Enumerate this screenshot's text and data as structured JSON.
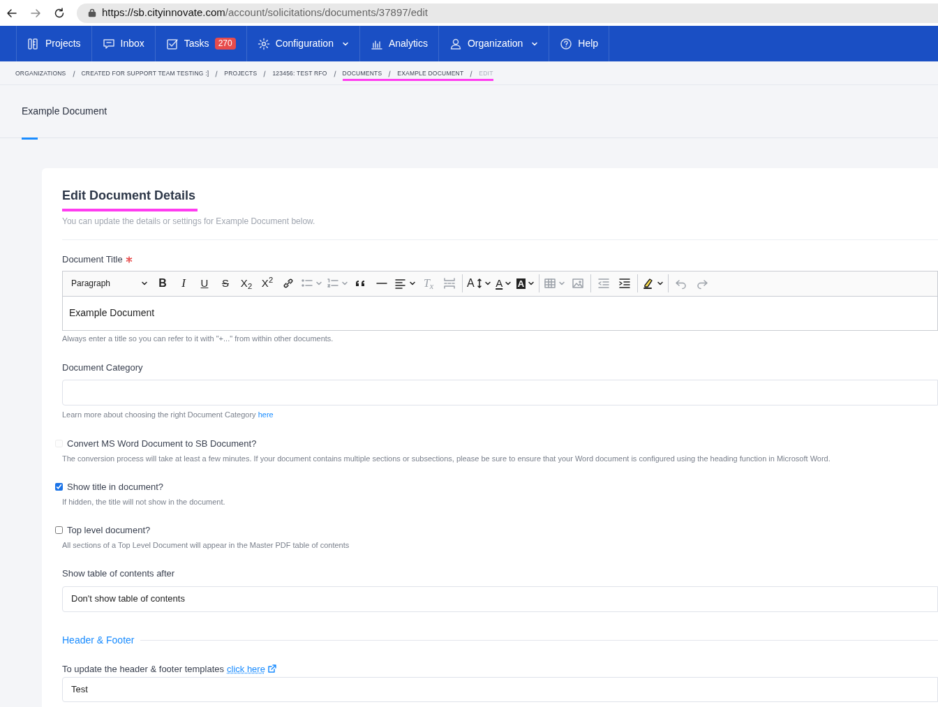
{
  "browser": {
    "url_host": "https://sb.cityinnovate.com",
    "url_path": "/account/solicitations/documents/37897/edit"
  },
  "nav": [
    {
      "label": "Projects",
      "dropdown": false
    },
    {
      "label": "Inbox",
      "dropdown": false
    },
    {
      "label": "Tasks",
      "badge": "270",
      "dropdown": false
    },
    {
      "label": "Configuration",
      "dropdown": true
    },
    {
      "label": "Analytics",
      "dropdown": false
    },
    {
      "label": "Organization",
      "dropdown": true
    },
    {
      "label": "Help",
      "dropdown": false
    }
  ],
  "breadcrumbs": [
    {
      "label": "ORGANIZATIONS",
      "current": false,
      "highlighted": false
    },
    {
      "label": "CREATED FOR SUPPORT TEAM TESTING :]",
      "current": false,
      "highlighted": false
    },
    {
      "label": "PROJECTS",
      "current": false,
      "highlighted": false
    },
    {
      "label": "123456: TEST RFO",
      "current": false,
      "highlighted": false
    },
    {
      "label": "DOCUMENTS",
      "current": false,
      "highlighted": true
    },
    {
      "label": "EXAMPLE DOCUMENT",
      "current": false,
      "highlighted": true
    },
    {
      "label": "EDIT",
      "current": true,
      "highlighted": true
    }
  ],
  "page_tabs": [
    {
      "label": "Example Document",
      "selected": true
    }
  ],
  "card": {
    "title": "Edit Document Details",
    "title_highlighted": true,
    "subtitle": "You can update the details or settings for Example Document below.",
    "title_field": {
      "label": "Document Title",
      "required": true,
      "block_style": "Paragraph",
      "value": "Example Document",
      "help": "Always enter a title so you can refer to it with \"+...\" from within other documents."
    },
    "toolbar": [
      {
        "kind": "bold",
        "text": "B",
        "disabled": false
      },
      {
        "kind": "italic",
        "text": "I",
        "disabled": false
      },
      {
        "kind": "underline",
        "text": "U",
        "disabled": false
      },
      {
        "kind": "strike",
        "text": "S",
        "disabled": false
      },
      {
        "kind": "subscript",
        "text": "X$_{2}$",
        "disabled": false
      },
      {
        "kind": "superscript",
        "text": "X$^{2}$",
        "disabled": false
      },
      {
        "kind": "link",
        "disabled": false
      },
      {
        "kind": "bullets",
        "disabled": true
      },
      {
        "kind": "numbers",
        "disabled": true
      },
      {
        "kind": "quote",
        "disabled": false
      },
      {
        "kind": "rule",
        "disabled": false
      },
      {
        "kind": "align",
        "disabled": false
      },
      {
        "kind": "clear",
        "text": "T$_{x}$",
        "disabled": true
      },
      {
        "kind": "pagebreak",
        "disabled": true
      },
      {
        "kind": "separator"
      },
      {
        "kind": "fontsize",
        "text": "A",
        "disabled": false
      },
      {
        "kind": "fontcolor",
        "text": "A",
        "disabled": false
      },
      {
        "kind": "bgcolor",
        "text": "A",
        "disabled": false
      },
      {
        "kind": "separator"
      },
      {
        "kind": "table",
        "disabled": true
      },
      {
        "kind": "image",
        "disabled": true
      },
      {
        "kind": "separator"
      },
      {
        "kind": "outdent",
        "disabled": true
      },
      {
        "kind": "indent",
        "disabled": false
      },
      {
        "kind": "separator"
      },
      {
        "kind": "highlight",
        "disabled": false
      },
      {
        "kind": "separator"
      },
      {
        "kind": "undo",
        "disabled": true
      },
      {
        "kind": "redo",
        "disabled": true
      }
    ],
    "category": {
      "label": "Document Category",
      "help": "Learn more about choosing the right Document Category",
      "help_link": "here"
    },
    "options": [
      {
        "label": "Convert MS Word Document to SB Document?",
        "checked": false,
        "disabled": true,
        "help": "The conversion process will take at least a few minutes. If your document contains multiple sections or subsections, please be sure to ensure that your Word document is configured using the heading function in Microsoft Word."
      },
      {
        "label": "Show title in document?",
        "checked": true,
        "disabled": false,
        "help": "If hidden, the title will not show in the document."
      },
      {
        "label": "Top level document?",
        "checked": false,
        "disabled": false,
        "help": "All sections of a Top Level Document will appear in the Master PDF table of contents"
      }
    ],
    "toc": {
      "label": "Show table of contents after",
      "value": "Don't show table of contents"
    },
    "section_heading": "Header & Footer",
    "header_footer": {
      "label": "To update the header & footer templates",
      "link": "click here",
      "value": "Test"
    }
  }
}
